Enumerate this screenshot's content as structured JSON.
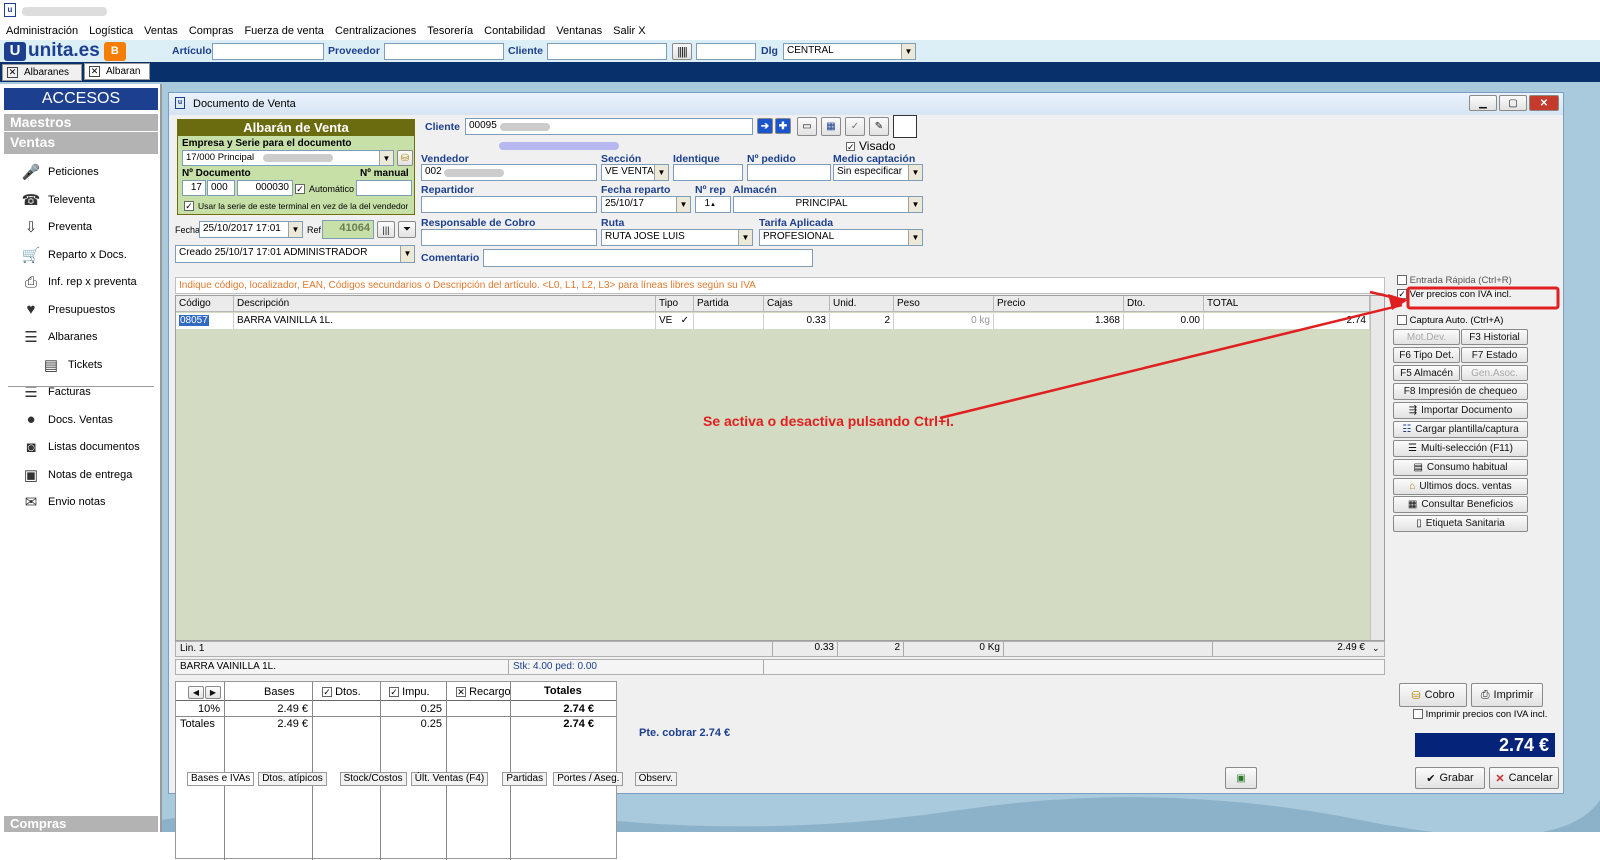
{
  "menu": {
    "items": [
      "Administración",
      "Logística",
      "Ventas",
      "Compras",
      "Fuerza de venta",
      "Centralizaciones",
      "Tesorería",
      "Contabilidad",
      "Ventanas",
      "Salir X"
    ]
  },
  "toolbar": {
    "brand": "unita.es",
    "articulo_label": "Artículo",
    "proveedor_label": "Proveedor",
    "cliente_label": "Cliente",
    "dlg_label": "Dlg",
    "dlg_value": "CENTRAL"
  },
  "tabs": [
    "Albaranes",
    "Albaran"
  ],
  "sidebar": {
    "title": "ACCESOS RAPIDOS",
    "maestros": "Maestros",
    "ventas": "Ventas",
    "compras": "Compras",
    "items": [
      {
        "label": "Peticiones",
        "icon": "microphone-icon",
        "glyph": "🎤"
      },
      {
        "label": "Televenta",
        "icon": "phone-icon",
        "glyph": "☎"
      },
      {
        "label": "Preventa",
        "icon": "download-icon",
        "glyph": "⇩"
      },
      {
        "label": "Reparto x Docs.",
        "icon": "cart-icon",
        "glyph": "🛒"
      },
      {
        "label": "Inf. rep x preventa",
        "icon": "printer-icon",
        "glyph": "⎙"
      },
      {
        "label": "Presupuestos",
        "icon": "heart-icon",
        "glyph": "♥"
      },
      {
        "label": "Albaranes",
        "icon": "list-icon",
        "glyph": "☰"
      },
      {
        "label": "Tickets",
        "icon": "ticket-icon",
        "glyph": "▤"
      },
      {
        "label": "Facturas",
        "icon": "invoice-icon",
        "glyph": "☰"
      },
      {
        "label": "Docs. Ventas",
        "icon": "pin-icon",
        "glyph": "●"
      },
      {
        "label": "Listas documentos",
        "icon": "tape-icon",
        "glyph": "◙"
      },
      {
        "label": "Notas de entrega",
        "icon": "box-icon",
        "glyph": "▣"
      },
      {
        "label": "Envio notas",
        "icon": "envelope-icon",
        "glyph": "✉"
      }
    ]
  },
  "window": {
    "title": "Documento de Venta"
  },
  "doc": {
    "header": "Albarán de Venta",
    "empresa_label": "Empresa y Serie para el documento",
    "empresa_value": "17/000 Principal",
    "ndoc_label": "Nº Documento",
    "nmanual_label": "Nº manual",
    "ndoc_a": "17",
    "ndoc_b": "000",
    "ndoc_c": "000030",
    "automatico": "Automático",
    "usar_serie": "Usar la serie de este terminal en vez de la del vendedor",
    "fecha_label": "Fecha",
    "fecha_value": "25/10/2017 17:01",
    "ref_label": "Ref",
    "ref_value": "41064",
    "creado": "Creado 25/10/17 17:01 ADMINISTRADOR"
  },
  "form": {
    "cliente_label": "Cliente",
    "cliente_value": "00095",
    "visado": "Visado",
    "vendedor_label": "Vendedor",
    "vendedor_value": "002",
    "seccion_label": "Sección",
    "seccion_value": "VE VENTA",
    "identique_label": "Identique",
    "npedido_label": "Nº pedido",
    "medio_label": "Medio captación",
    "medio_value": "Sin especificar",
    "repartidor_label": "Repartidor",
    "fecha_reparto_label": "Fecha reparto",
    "fecha_reparto_value": "25/10/17",
    "nrep_label": "Nº rep",
    "nrep_value": "1",
    "almacen_label": "Almacén",
    "almacen_value": "PRINCIPAL",
    "resp_label": "Responsable de Cobro",
    "ruta_label": "Ruta",
    "ruta_value": "RUTA JOSE LUIS",
    "tarifa_label": "Tarifa Aplicada",
    "tarifa_value": "PROFESIONAL",
    "comentario_label": "Comentario"
  },
  "grid": {
    "hint": "Indique código, localizador, EAN, Códigos secundarios o Descripción del artículo. <L0, L1, L2, L3> para líneas libres según su IVA",
    "headers": [
      "Código",
      "Descripción",
      "Tipo",
      "Partida",
      "Cajas",
      "Unid.",
      "Peso",
      "Precio",
      "Dto.",
      "TOTAL"
    ],
    "row": {
      "codigo": "08057",
      "descripcion": "BARRA VAINILLA 1L.",
      "tipo": "VE",
      "partida": "",
      "cajas": "0.33",
      "unid": "2",
      "peso": "0 kg",
      "precio": "1.368",
      "dto": "0.00",
      "total": "2.74"
    },
    "footer": {
      "lin": "Lin. 1",
      "cajas": "0.33",
      "unid": "2",
      "peso": "0 Kg",
      "total": "2.49 €"
    },
    "status_desc": "BARRA VAINILLA 1L.",
    "status_stk": "Stk: 4.00 ped: 0.00"
  },
  "annotation": "Se activa o desactiva pulsando Ctrl+i.",
  "right_panel": {
    "entrada_rapida": "Entrada Rápida (Ctrl+R)",
    "ver_precios": "Ver precios con IVA incl.",
    "captura_auto": "Captura Auto. (Ctrl+A)",
    "mot_dev": "Mot.Dev.",
    "historial": "F3 Historial",
    "tipo_det": "F6 Tipo Det.",
    "estado": "F7 Estado",
    "almacen": "F5 Almacén",
    "gen_asoc": "Gen.Asoc.",
    "impresion_cheque": "F8 Impresión de chequeo",
    "importar": "Importar Documento",
    "cargar": "Cargar plantilla/captura",
    "multi": "Multi-selección (F11)",
    "consumo": "Consumo habitual",
    "ultimos": "Ultimos docs. ventas",
    "beneficios": "Consultar Beneficios",
    "etiqueta": "Etiqueta Sanitaria"
  },
  "totals": {
    "headers": [
      "Bases",
      "Dtos.",
      "Impu.",
      "Recargo",
      "Totales"
    ],
    "row1": {
      "label": "10%",
      "bases": "2.49 €",
      "impu": "0.25",
      "totales": "2.74 €"
    },
    "row2": {
      "label": "Totales",
      "bases": "2.49 €",
      "impu": "0.25",
      "totales": "2.74 €"
    },
    "tabs": [
      "Bases e IVAs",
      "Dtos. atípicos",
      "Stock/Costos",
      "Últ. Ventas (F4)",
      "Partidas",
      "Portes / Aseg.",
      "Observ."
    ],
    "pte_cobrar": "Pte. cobrar 2.74 €"
  },
  "actions": {
    "cobro": "Cobro",
    "imprimir": "Imprimir",
    "imprimir_iva": "Imprimir precios con IVA incl.",
    "total": "2.74 €",
    "grabar": "Grabar",
    "cancelar": "Cancelar"
  }
}
